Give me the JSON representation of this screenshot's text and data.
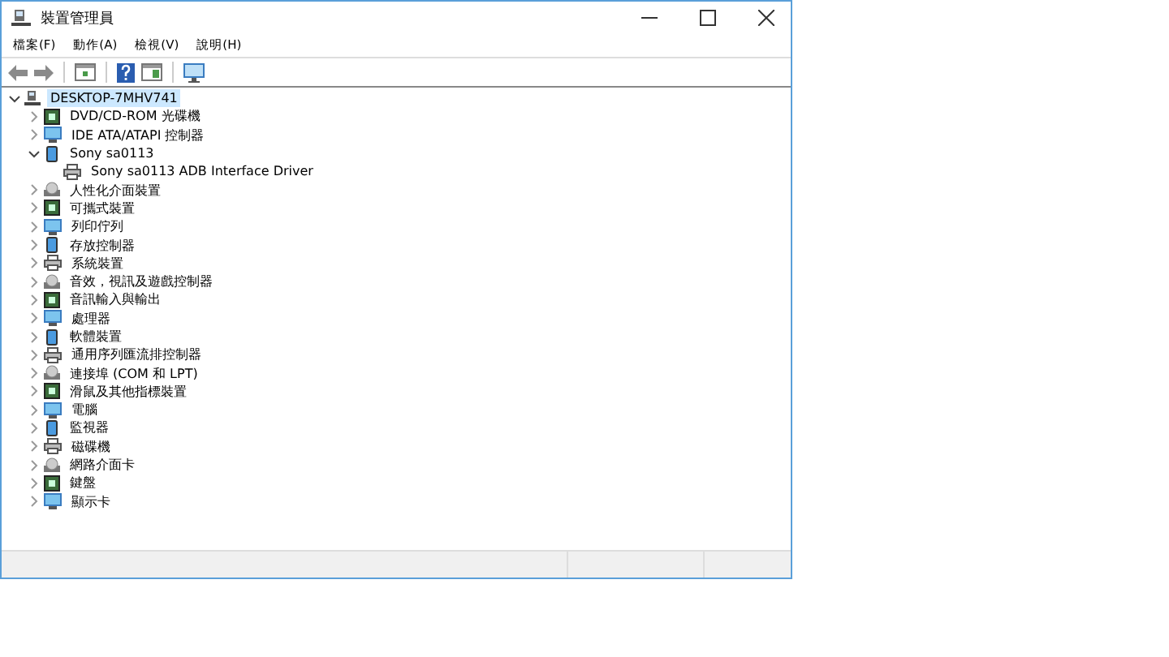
{
  "window": {
    "title": "裝置管理員"
  },
  "menu": [
    "檔案(F)",
    "動作(A)",
    "檢視(V)",
    "說明(H)"
  ],
  "tree": [
    {
      "label": "DESKTOP-7MHV741",
      "selected": true,
      "expanded": true,
      "children": [
        {
          "label": "DVD/CD-ROM 光碟機",
          "selected": false,
          "expanded": false
        },
        {
          "label": "IDE ATA/ATAPI 控制器",
          "selected": false,
          "expanded": false
        },
        {
          "label": "Sony sa0113",
          "selected": false,
          "expanded": true,
          "children": [
            {
              "label": "Sony sa0113 ADB Interface Driver",
              "selected": false
            }
          ]
        },
        {
          "label": "人性化介面裝置",
          "selected": false,
          "expanded": false
        },
        {
          "label": "可攜式裝置",
          "selected": false,
          "expanded": false
        },
        {
          "label": "列印佇列",
          "selected": false,
          "expanded": false
        },
        {
          "label": "存放控制器",
          "selected": false,
          "expanded": false
        },
        {
          "label": "系統裝置",
          "selected": false,
          "expanded": false
        },
        {
          "label": "音效，視訊及遊戲控制器",
          "selected": false,
          "expanded": false
        },
        {
          "label": "音訊輸入與輸出",
          "selected": false,
          "expanded": false
        },
        {
          "label": "處理器",
          "selected": false,
          "expanded": false
        },
        {
          "label": "軟體裝置",
          "selected": false,
          "expanded": false
        },
        {
          "label": "通用序列匯流排控制器",
          "selected": false,
          "expanded": false
        },
        {
          "label": "連接埠 (COM 和 LPT)",
          "selected": false,
          "expanded": false
        },
        {
          "label": "滑鼠及其他指標裝置",
          "selected": false,
          "expanded": false
        },
        {
          "label": "電腦",
          "selected": false,
          "expanded": false
        },
        {
          "label": "監視器",
          "selected": false,
          "expanded": false
        },
        {
          "label": "磁碟機",
          "selected": false,
          "expanded": false
        },
        {
          "label": "網路介面卡",
          "selected": false,
          "expanded": false
        },
        {
          "label": "鍵盤",
          "selected": false,
          "expanded": false
        },
        {
          "label": "顯示卡",
          "selected": false,
          "expanded": false
        }
      ]
    }
  ]
}
